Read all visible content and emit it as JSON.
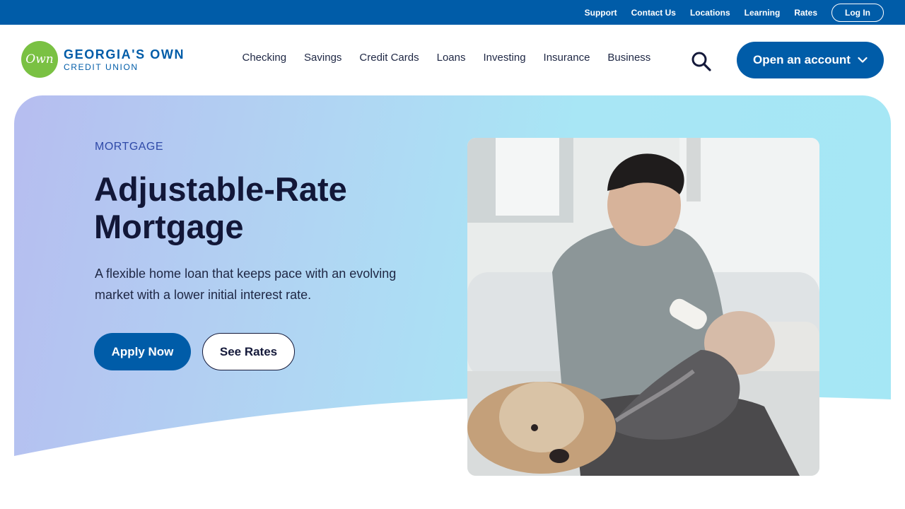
{
  "utility_nav": {
    "links": [
      "Support",
      "Contact Us",
      "Locations",
      "Learning",
      "Rates"
    ],
    "login_label": "Log In"
  },
  "brand": {
    "badge_text": "Own",
    "name": "GEORGIA'S OWN",
    "subtitle": "CREDIT UNION",
    "primary_color": "#005ca8",
    "accent_color": "#7ac143"
  },
  "main_nav": {
    "links": [
      "Checking",
      "Savings",
      "Credit Cards",
      "Loans",
      "Investing",
      "Insurance",
      "Business"
    ],
    "search_icon": "search-icon",
    "open_account_label": "Open an account"
  },
  "hero": {
    "eyebrow": "MORTGAGE",
    "title": "Adjustable-Rate Mortgage",
    "description": "A flexible home loan that keeps pace with an evolving market with a lower initial interest rate.",
    "apply_label": "Apply Now",
    "rates_label": "See Rates"
  }
}
